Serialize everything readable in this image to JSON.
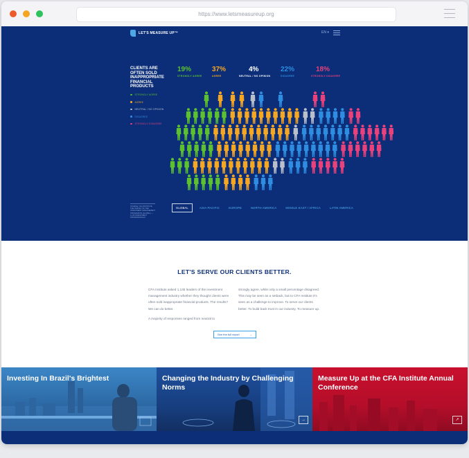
{
  "browser": {
    "url": "https://www.letsmeasureup.org"
  },
  "header": {
    "logo_text": "LET'S MEASURE UP™",
    "language": "EN ▾"
  },
  "question": "CLIENTS ARE OFTEN SOLD INAPPROPRIATE FINANCIAL PRODUCTS",
  "colors": {
    "strongly_agree": "#5cc02f",
    "agree": "#f5a623",
    "neutral": "#b9c0cc",
    "disagree": "#2e8de0",
    "strongly_disagree": "#e8417c",
    "navy": "#0c2e78"
  },
  "legend": [
    {
      "label": "STRONGLY AGREE",
      "color": "#5cc02f"
    },
    {
      "label": "AGREE",
      "color": "#f5a623"
    },
    {
      "label": "NEUTRAL / NO OPINION",
      "color": "#b9c0cc"
    },
    {
      "label": "DISAGREE",
      "color": "#2e8de0"
    },
    {
      "label": "STRONGLY DISAGREE",
      "color": "#e8417c"
    }
  ],
  "stats": [
    {
      "percent": "19%",
      "label": "STRONGLY AGREE",
      "color": "#5cc02f"
    },
    {
      "percent": "37%",
      "label": "AGREE",
      "color": "#f5a623"
    },
    {
      "percent": "4%",
      "label": "NEUTRAL / NO OPINION",
      "color": "#ffffff"
    },
    {
      "percent": "22%",
      "label": "DISAGREE",
      "color": "#2e8de0"
    },
    {
      "percent": "18%",
      "label": "STRONGLY DISAGREE",
      "color": "#e8417c"
    }
  ],
  "source_note": "SOURCE: CFA INSTITUTE, THE SURVEY OF THE INVESTMENT MANAGEMENT PROFESSION (GLOBAL) — 1,145 INVESTMENT PROFESSIONALS",
  "regions": [
    "GLOBAL",
    "ASIA PACIFIC",
    "EUROPE",
    "NORTH AMERICA",
    "MIDDLE EAST / AFRICA",
    "LATIN AMERICA"
  ],
  "serve": {
    "title": "LET'S SERVE OUR CLIENTS BETTER.",
    "col1_p1": "CFA Institute asked 1,145 leaders of the investment management industry whether they thought clients were often sold inappropriate financial products. The results? We can do better.",
    "col1_p2": "A majority of responses ranged from neutral to",
    "col2_p1": "strongly agree, while only a small percentage disagreed. This may be seen as a setback, but to CFA Institute it's seen as a challenge to improve. To serve our clients better. To build back trust in our industry. To measure up.",
    "button": "See the full report",
    "button_arrow": "→"
  },
  "cards": [
    {
      "title": "Investing In Brazil's Brightest",
      "arrow": "→"
    },
    {
      "title": "Changing the Industry by Challenging Norms",
      "arrow": "→"
    },
    {
      "title": "Measure Up at the CFA Institute Annual Conference",
      "arrow": "↗"
    }
  ]
}
